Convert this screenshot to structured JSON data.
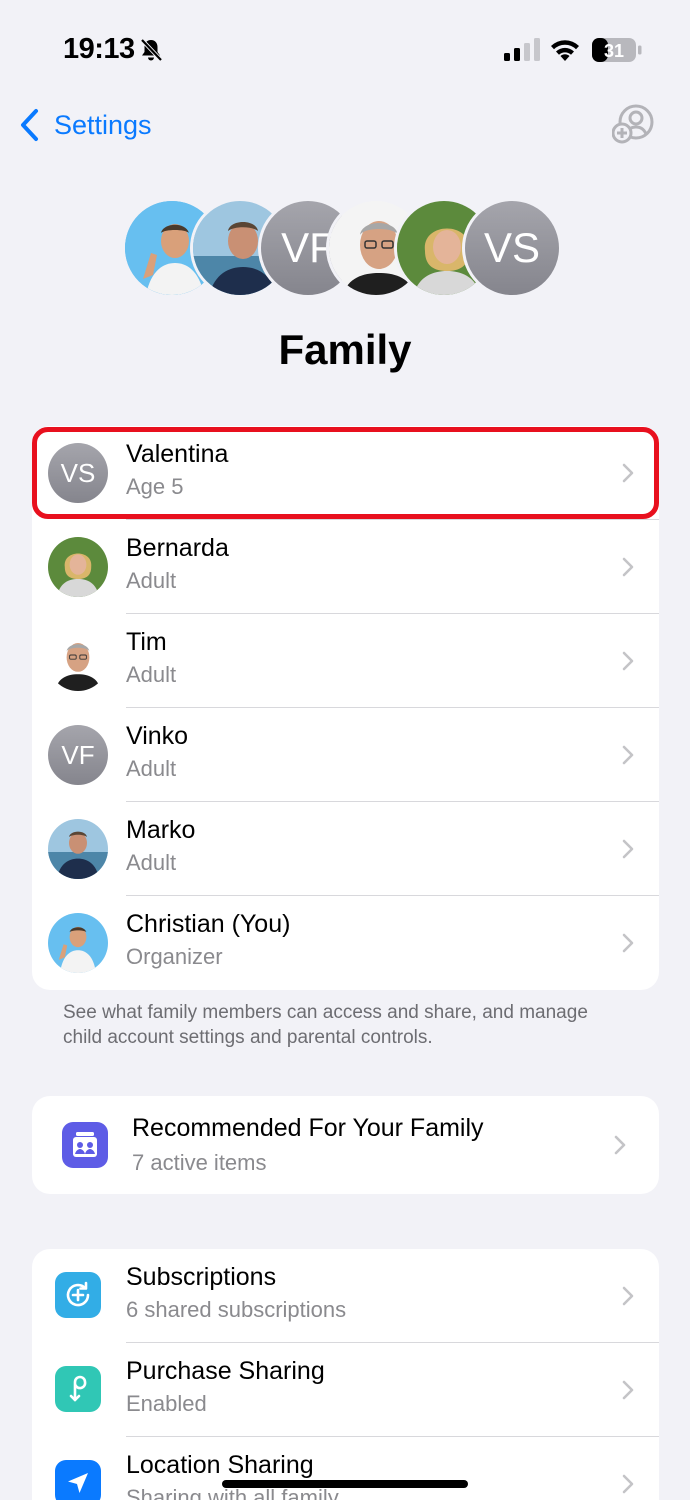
{
  "status_bar": {
    "time": "19:13",
    "battery": "31"
  },
  "nav": {
    "back_label": "Settings"
  },
  "header": {
    "avatars": [
      {
        "type": "photo",
        "person": "Christian"
      },
      {
        "type": "photo",
        "person": "Marko"
      },
      {
        "type": "initials",
        "initials": "VF"
      },
      {
        "type": "photo",
        "person": "Tim"
      },
      {
        "type": "photo",
        "person": "Bernarda"
      },
      {
        "type": "initials",
        "initials": "VS"
      }
    ],
    "title": "Family"
  },
  "members": [
    {
      "name": "Valentina",
      "role": "Age 5",
      "initials": "VS",
      "highlighted": true
    },
    {
      "name": "Bernarda",
      "role": "Adult"
    },
    {
      "name": "Tim",
      "role": "Adult"
    },
    {
      "name": "Vinko",
      "role": "Adult",
      "initials": "VF"
    },
    {
      "name": "Marko",
      "role": "Adult"
    },
    {
      "name": "Christian (You)",
      "role": "Organizer"
    }
  ],
  "members_footer": "See what family members can access and share, and manage child account settings and parental controls.",
  "recommended": {
    "title": "Recommended For Your Family",
    "subtitle": "7 active items",
    "icon": "family-checklist-icon",
    "color": "#5e5ce6"
  },
  "features": [
    {
      "title": "Subscriptions",
      "subtitle": "6 shared subscriptions",
      "icon": "subscriptions-icon",
      "color": "#32ade6"
    },
    {
      "title": "Purchase Sharing",
      "subtitle": "Enabled",
      "icon": "purchase-sharing-icon",
      "color": "#30c7b5"
    },
    {
      "title": "Location Sharing",
      "subtitle": "Sharing with all family",
      "icon": "location-arrow-icon",
      "color": "#0a7aff"
    }
  ],
  "colors": {
    "accent": "#0a7aff",
    "highlight": "#e8101e"
  }
}
